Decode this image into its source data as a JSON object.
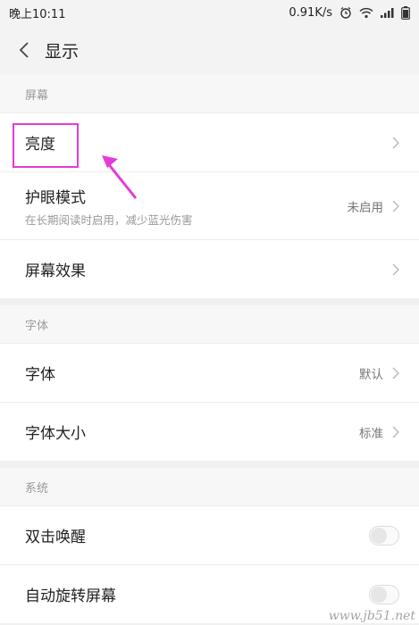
{
  "status_bar": {
    "time": "晚上10:11",
    "net_speed": "0.91K/s",
    "icons": [
      "alarm-icon",
      "wifi-icon",
      "signal-icon",
      "battery-icon"
    ]
  },
  "header": {
    "title": "显示",
    "back_icon": "chevron-left-icon"
  },
  "sections": {
    "screen": {
      "title": "屏幕",
      "brightness": {
        "label": "亮度"
      },
      "eye_care": {
        "label": "护眼模式",
        "sub": "在长期阅读时启用，减少蓝光伤害",
        "value": "未启用"
      },
      "screen_effect": {
        "label": "屏幕效果"
      }
    },
    "font": {
      "title": "字体",
      "font": {
        "label": "字体",
        "value": "默认"
      },
      "font_size": {
        "label": "字体大小",
        "value": "标准"
      }
    },
    "system": {
      "title": "系统",
      "double_tap": {
        "label": "双击唤醒",
        "enabled": false
      },
      "auto_rotate": {
        "label": "自动旋转屏幕",
        "enabled": false
      }
    }
  },
  "annotation": {
    "color": "#e53ad8"
  },
  "watermark": "www.jb51.net"
}
